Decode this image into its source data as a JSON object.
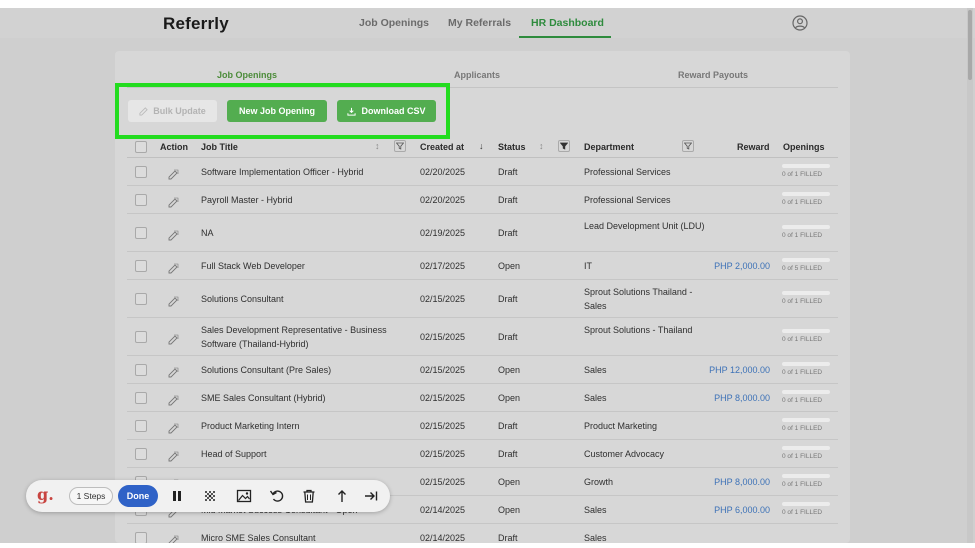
{
  "app": {
    "logo": "Referrly"
  },
  "nav": {
    "items": [
      {
        "label": "Job Openings"
      },
      {
        "label": "My Referrals"
      },
      {
        "label": "HR Dashboard"
      }
    ]
  },
  "tabs": [
    {
      "label": "Job Openings"
    },
    {
      "label": "Applicants"
    },
    {
      "label": "Reward Payouts"
    }
  ],
  "actions": {
    "bulk_update": "Bulk Update",
    "new_job": "New Job Opening",
    "download_csv": "Download CSV"
  },
  "table": {
    "headers": {
      "action": "Action",
      "title": "Job Title",
      "created": "Created at",
      "status": "Status",
      "department": "Department",
      "reward": "Reward",
      "openings": "Openings"
    },
    "rows": [
      {
        "title": "Software Implementation Officer - Hybrid",
        "created": "02/20/2025",
        "status": "Draft",
        "department": "Professional Services",
        "reward": "",
        "openings": "0 of 1 FILLED"
      },
      {
        "title": "Payroll Master - Hybrid",
        "created": "02/20/2025",
        "status": "Draft",
        "department": "Professional Services",
        "reward": "",
        "openings": "0 of 1 FILLED"
      },
      {
        "title": "NA",
        "created": "02/19/2025",
        "status": "Draft",
        "department": "Lead Development Unit (LDU)",
        "reward": "",
        "openings": "0 of 1 FILLED"
      },
      {
        "title": "Full Stack Web Developer",
        "created": "02/17/2025",
        "status": "Open",
        "department": "IT",
        "reward": "PHP 2,000.00",
        "openings": "0 of 5 FILLED"
      },
      {
        "title": "Solutions Consultant",
        "created": "02/15/2025",
        "status": "Draft",
        "department": "Sprout Solutions Thailand - Sales",
        "reward": "",
        "openings": "0 of 1 FILLED"
      },
      {
        "title": "Sales Development Representative - Business Software (Thailand-Hybrid)",
        "created": "02/15/2025",
        "status": "Draft",
        "department": "Sprout Solutions - Thailand",
        "reward": "",
        "openings": "0 of 1 FILLED"
      },
      {
        "title": "Solutions Consultant (Pre Sales)",
        "created": "02/15/2025",
        "status": "Open",
        "department": "Sales",
        "reward": "PHP 12,000.00",
        "openings": "0 of 1 FILLED"
      },
      {
        "title": "SME Sales Consultant (Hybrid)",
        "created": "02/15/2025",
        "status": "Open",
        "department": "Sales",
        "reward": "PHP 8,000.00",
        "openings": "0 of 1 FILLED"
      },
      {
        "title": "Product Marketing Intern",
        "created": "02/15/2025",
        "status": "Draft",
        "department": "Product Marketing",
        "reward": "",
        "openings": "0 of 1 FILLED"
      },
      {
        "title": "Head of Support",
        "created": "02/15/2025",
        "status": "Draft",
        "department": "Customer Advocacy",
        "reward": "",
        "openings": "0 of 1 FILLED"
      },
      {
        "title": "",
        "created": "02/15/2025",
        "status": "Open",
        "department": "Growth",
        "reward": "PHP 8,000.00",
        "openings": "0 of 1 FILLED"
      },
      {
        "title": "Mid Market Success Consultant - Open",
        "created": "02/14/2025",
        "status": "Open",
        "department": "Sales",
        "reward": "PHP 6,000.00",
        "openings": "0 of 1 FILLED"
      },
      {
        "title": "Micro SME Sales Consultant",
        "created": "02/14/2025",
        "status": "Draft",
        "department": "Sales",
        "reward": "",
        "openings": ""
      }
    ]
  },
  "recorder": {
    "steps": "1 Steps",
    "done": "Done",
    "icons": [
      "pause-icon",
      "blur-icon",
      "image-icon",
      "undo-icon",
      "trash-icon",
      "upload-icon",
      "skip-end-icon"
    ]
  }
}
